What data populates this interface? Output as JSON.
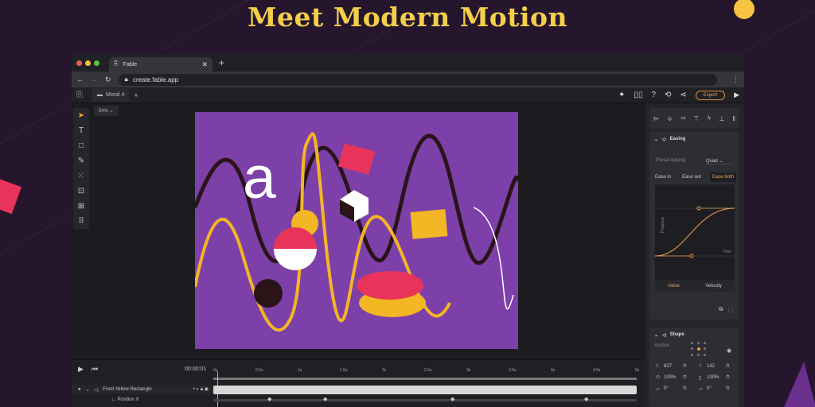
{
  "headline": "Meet Modern Motion",
  "browser": {
    "tab_title": "Fable",
    "url": "create.fable.app"
  },
  "app": {
    "doc_tab": "Moral 4",
    "zoom": "54%",
    "export_label": "Export"
  },
  "easing": {
    "title": "Easing",
    "preset_label": "Preset easing",
    "preset_value": "Quad",
    "buttons": [
      "Ease in",
      "Ease out",
      "Ease both"
    ],
    "active": "Ease both",
    "y_axis": "Progress",
    "x_axis": "Time",
    "tabs": [
      "Value",
      "Velocity"
    ]
  },
  "shape": {
    "title": "Shape",
    "anchor_label": "Anchor",
    "x_label": "X",
    "x": "627",
    "y_label": "Y",
    "y": "142",
    "scale_x": "100%",
    "scale_y": "100%",
    "skew1": "0°",
    "skew2": "0°"
  },
  "timeline": {
    "time": "00:00:01",
    "ticks": [
      "0s",
      "0.5s",
      "1s",
      "1.5s",
      "2s",
      "2.5s",
      "3s",
      "3.5s",
      "4s",
      "4.5s",
      "5s"
    ],
    "layer": "Front Yellow Rectangle",
    "property": "Position X"
  },
  "artboard_letter": "a",
  "colors": {
    "accent": "#f6cf4a",
    "artboard": "#7d40a8",
    "export": "#d9913e"
  }
}
